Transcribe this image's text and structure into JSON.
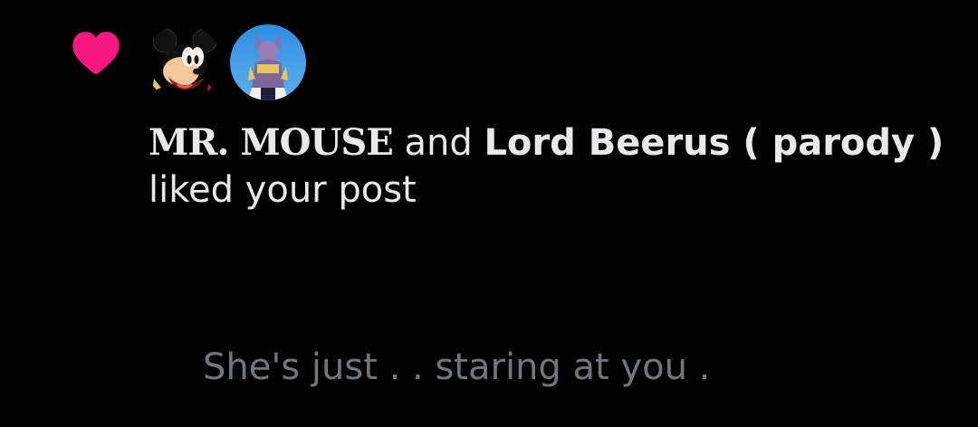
{
  "notification": {
    "type_icon": "heart-icon",
    "accent_color": "#f91880",
    "avatars": [
      {
        "icon": "mickey-mouse-avatar"
      },
      {
        "icon": "beerus-avatar"
      }
    ],
    "user1": "MR. MOUSE",
    "connector": " and ",
    "user2": "Lord Beerus ( parody )",
    "action": "liked your post",
    "post_preview": "She's just . . staring at you ."
  }
}
